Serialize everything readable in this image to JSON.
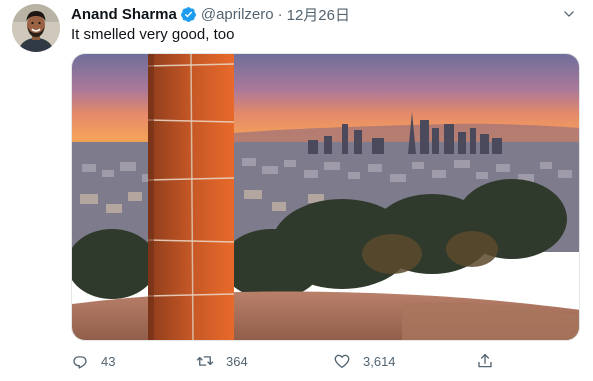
{
  "user": {
    "display_name": "Anand Sharma",
    "handle": "@aprilzero",
    "separator": "·",
    "date": "12月26日",
    "verified": true
  },
  "tweet": {
    "text": "It smelled very good, too"
  },
  "actions": {
    "reply_count": "43",
    "retweet_count": "364",
    "like_count": "3,614"
  },
  "icons": {
    "avatar": "avatar-photo",
    "verified": "verified-badge-icon",
    "more": "chevron-down-icon",
    "reply": "reply-icon",
    "retweet": "retweet-icon",
    "like": "heart-icon",
    "share": "share-icon"
  },
  "colors": {
    "verified_blue": "#1d9bf0",
    "secondary_text": "#536471",
    "primary_text": "#0f1419"
  }
}
